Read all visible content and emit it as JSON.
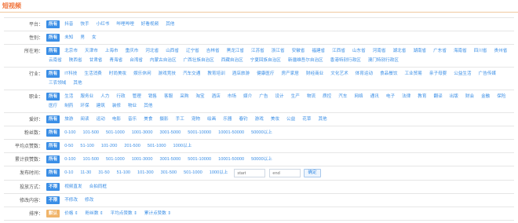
{
  "page_title": "短视频",
  "filters": [
    {
      "label": "平台：",
      "options": [
        "所有",
        "抖音",
        "快手",
        "小红书",
        "哔哩哔哩",
        "好看视频",
        "其他"
      ]
    },
    {
      "label": "性别：",
      "options": [
        "所有",
        "未知",
        "男",
        "女"
      ]
    },
    {
      "label": "所在地：",
      "options": [
        "所有",
        "北京市",
        "天津市",
        "上海市",
        "重庆市",
        "河北省",
        "山西省",
        "辽宁省",
        "吉林省",
        "黑龙江省",
        "江苏省",
        "浙江省",
        "安徽省",
        "福建省",
        "江西省",
        "山东省",
        "河南省",
        "湖北省",
        "湖南省",
        "广东省",
        "海南省",
        "四川省",
        "贵州省",
        "云南省",
        "陕西省",
        "甘肃省",
        "青海省",
        "台湾省",
        "内蒙古自治区",
        "广西壮族自治区",
        "西藏自治区",
        "宁夏回族自治区",
        "新疆维吾尔自治区",
        "香港特别行政区",
        "澳门特别行政区"
      ]
    },
    {
      "label": "行业：",
      "options": [
        "所有",
        "IT科技",
        "生活消费",
        "时尚美妆",
        "娱乐休闲",
        "游戏竞技",
        "汽车交通",
        "教育培训",
        "酒店旅游",
        "健康医疗",
        "房产家居",
        "财经商业",
        "文化艺术",
        "体育运动",
        "食品餐饮",
        "工业贸易",
        "亲子母婴",
        "公益生活",
        "广告传媒",
        "三农领域",
        "其他"
      ]
    },
    {
      "label": "职业：",
      "options": [
        "所有",
        "生活",
        "服务业",
        "人力",
        "行政",
        "管理",
        "销售",
        "客服",
        "采购",
        "淘宝",
        "酒店",
        "市场",
        "媒介",
        "广告",
        "设计",
        "生产",
        "物流",
        "质控",
        "汽车",
        "网络",
        "通讯",
        "电子",
        "法律",
        "教育",
        "翻译",
        "出版",
        "财会",
        "金融",
        "保险",
        "医疗",
        "制药",
        "环保",
        "建筑",
        "装修",
        "物业",
        "其他"
      ]
    },
    {
      "label": "爱好：",
      "options": [
        "所有",
        "旅游",
        "阅读",
        "运动",
        "电影",
        "音乐",
        "美食",
        "摄影",
        "手工",
        "宠物",
        "绘画",
        "乐器",
        "春钓",
        "游戏",
        "美妆",
        "公益",
        "花草",
        "其他"
      ]
    },
    {
      "label": "粉丝数：",
      "options": [
        "所有",
        "0-100",
        "101-500",
        "501-1000",
        "1001-3000",
        "3001-5000",
        "5001-10000",
        "10001-50000",
        "50000以上"
      ]
    },
    {
      "label": "平均点赞数：",
      "options": [
        "所有",
        "0-50",
        "51-100",
        "101-200",
        "201-500",
        "501-1000",
        "1000以上"
      ]
    },
    {
      "label": "累计获赞数：",
      "options": [
        "所有",
        "0-100",
        "101-500",
        "501-1000",
        "1001-3000",
        "3001-5000",
        "5001-10000",
        "10001-50000",
        "50000以上"
      ]
    }
  ],
  "publish_time": {
    "label": "发布时间：",
    "options": [
      "所有",
      "0-10",
      "11-30",
      "31-50",
      "51-100",
      "101-300",
      "301-500",
      "501-1000",
      "1000以上"
    ],
    "start_placeholder": "start",
    "end_placeholder": "end",
    "confirm_label": "确定"
  },
  "delivery": {
    "label": "投放方式：",
    "options": [
      "不限",
      "视频直发",
      "合拍同框"
    ]
  },
  "editable": {
    "label": "修改内容：",
    "options": [
      "不限",
      "不修改",
      "修改"
    ]
  },
  "sort": {
    "label": "排序：",
    "options": [
      "默认",
      "价格 ⇕",
      "粉丝数 ⇕",
      "平均点赞数 ⇕",
      "累计点赞数 ⇕"
    ]
  },
  "colors": {
    "accent": "#3a8ee6",
    "title": "#f0733a",
    "sort_active": "#f0b46a"
  }
}
